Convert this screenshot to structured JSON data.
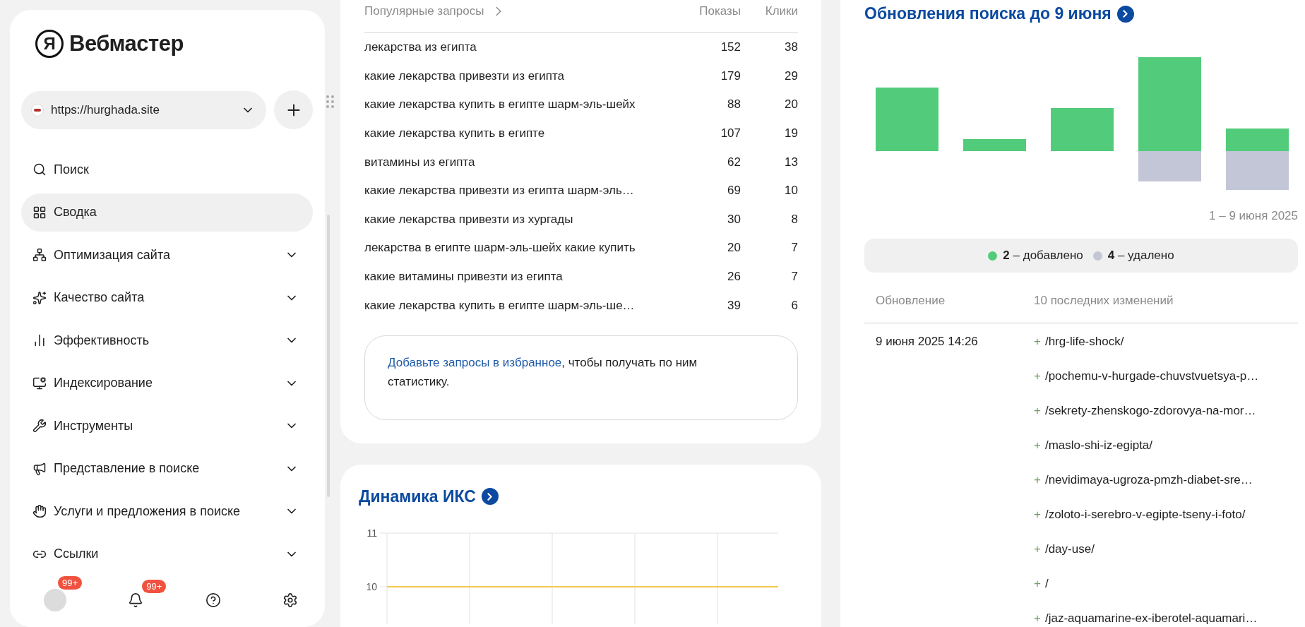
{
  "sidebar": {
    "logo": {
      "mark": "Я",
      "title": "Вебмастер"
    },
    "site": {
      "url": "https://hurghada.site"
    },
    "nav": [
      {
        "label": "Поиск",
        "kind": "link",
        "selected": false
      },
      {
        "label": "Сводка",
        "kind": "link",
        "selected": true
      },
      {
        "label": "Оптимизация сайта",
        "kind": "group",
        "selected": false,
        "expanded": false
      },
      {
        "label": "Качество сайта",
        "kind": "group",
        "selected": false,
        "expanded": false
      },
      {
        "label": "Эффективность",
        "kind": "group",
        "selected": false,
        "expanded": false
      },
      {
        "label": "Индексирование",
        "kind": "group",
        "selected": false,
        "expanded": false
      },
      {
        "label": "Инструменты",
        "kind": "group",
        "selected": false,
        "expanded": false
      },
      {
        "label": "Представление в поиске",
        "kind": "group",
        "selected": false,
        "expanded": false
      },
      {
        "label": "Услуги и предложения в поиске",
        "kind": "group",
        "selected": false,
        "expanded": false
      },
      {
        "label": "Ссылки",
        "kind": "group",
        "selected": false,
        "expanded": false
      }
    ],
    "footer": {
      "profile_badge": "99+",
      "notifications_badge": "99+"
    }
  },
  "popular_queries": {
    "title": "Популярные запросы",
    "columns": [
      "Показы",
      "Клики"
    ],
    "rows": [
      {
        "query": "лекарства из египта",
        "shows": "152",
        "clicks": "38"
      },
      {
        "query": "какие лекарства привезти из египта",
        "shows": "179",
        "clicks": "29"
      },
      {
        "query": "какие лекарства купить в египте шарм-эль-шейх",
        "shows": "88",
        "clicks": "20"
      },
      {
        "query": "какие лекарства купить в египте",
        "shows": "107",
        "clicks": "19"
      },
      {
        "query": "витамины из египта",
        "shows": "62",
        "clicks": "13"
      },
      {
        "query": "какие лекарства привезти из египта шарм-эль…",
        "shows": "69",
        "clicks": "10"
      },
      {
        "query": "какие лекарства привезти из хургады",
        "shows": "30",
        "clicks": "8"
      },
      {
        "query": "лекарства в египте шарм-эль-шейх какие купить",
        "shows": "20",
        "clicks": "7"
      },
      {
        "query": "какие витамины привезти из египта",
        "shows": "26",
        "clicks": "7"
      },
      {
        "query": "какие лекарства купить в египте шарм-эль-ше…",
        "shows": "39",
        "clicks": "6"
      }
    ],
    "note": {
      "link": "Добавьте запросы в избранное",
      "text": ", чтобы получать по ним статистику."
    }
  },
  "iks": {
    "title": "Динамика ИКС",
    "chart_data": {
      "type": "line",
      "ylim": [
        9.3,
        11
      ],
      "yticks": [
        10,
        11
      ],
      "series": [
        {
          "color": "#f5c84a",
          "values": [
            10,
            10,
            10,
            10,
            10,
            10
          ]
        }
      ]
    }
  },
  "search_updates": {
    "title": "Обновления поиска до 9 июня",
    "period": "1 – 9 июня 2025",
    "legend": [
      {
        "text": "**2** – добавлено",
        "color": "#52cc7a"
      },
      {
        "text": "**4** – удалено",
        "color": "#c3c6d6"
      }
    ],
    "columns": [
      "Обновление",
      "10 последних изменений"
    ],
    "rows": [
      {
        "date": "9 июня 2025 14:26",
        "changes": [
          {
            "sign": "+",
            "path": "/hrg-life-shock/"
          },
          {
            "sign": "+",
            "path": "/pochemu-v-hurgade-chuvstvuetsya-p…"
          },
          {
            "sign": "+",
            "path": "/sekrety-zhenskogo-zdorovya-na-mor…"
          },
          {
            "sign": "+",
            "path": "/maslo-shi-iz-egipta/"
          },
          {
            "sign": "+",
            "path": "/nevidimaya-ugroza-pmzh-diabet-sre…"
          },
          {
            "sign": "+",
            "path": "/zoloto-i-serebro-v-egipte-tseny-i-foto/"
          },
          {
            "sign": "+",
            "path": "/day-use/"
          },
          {
            "sign": "+",
            "path": "/"
          },
          {
            "sign": "+",
            "path": "/jaz-aquamarine-ex-iberotel-aquamari…"
          }
        ]
      }
    ]
  }
}
